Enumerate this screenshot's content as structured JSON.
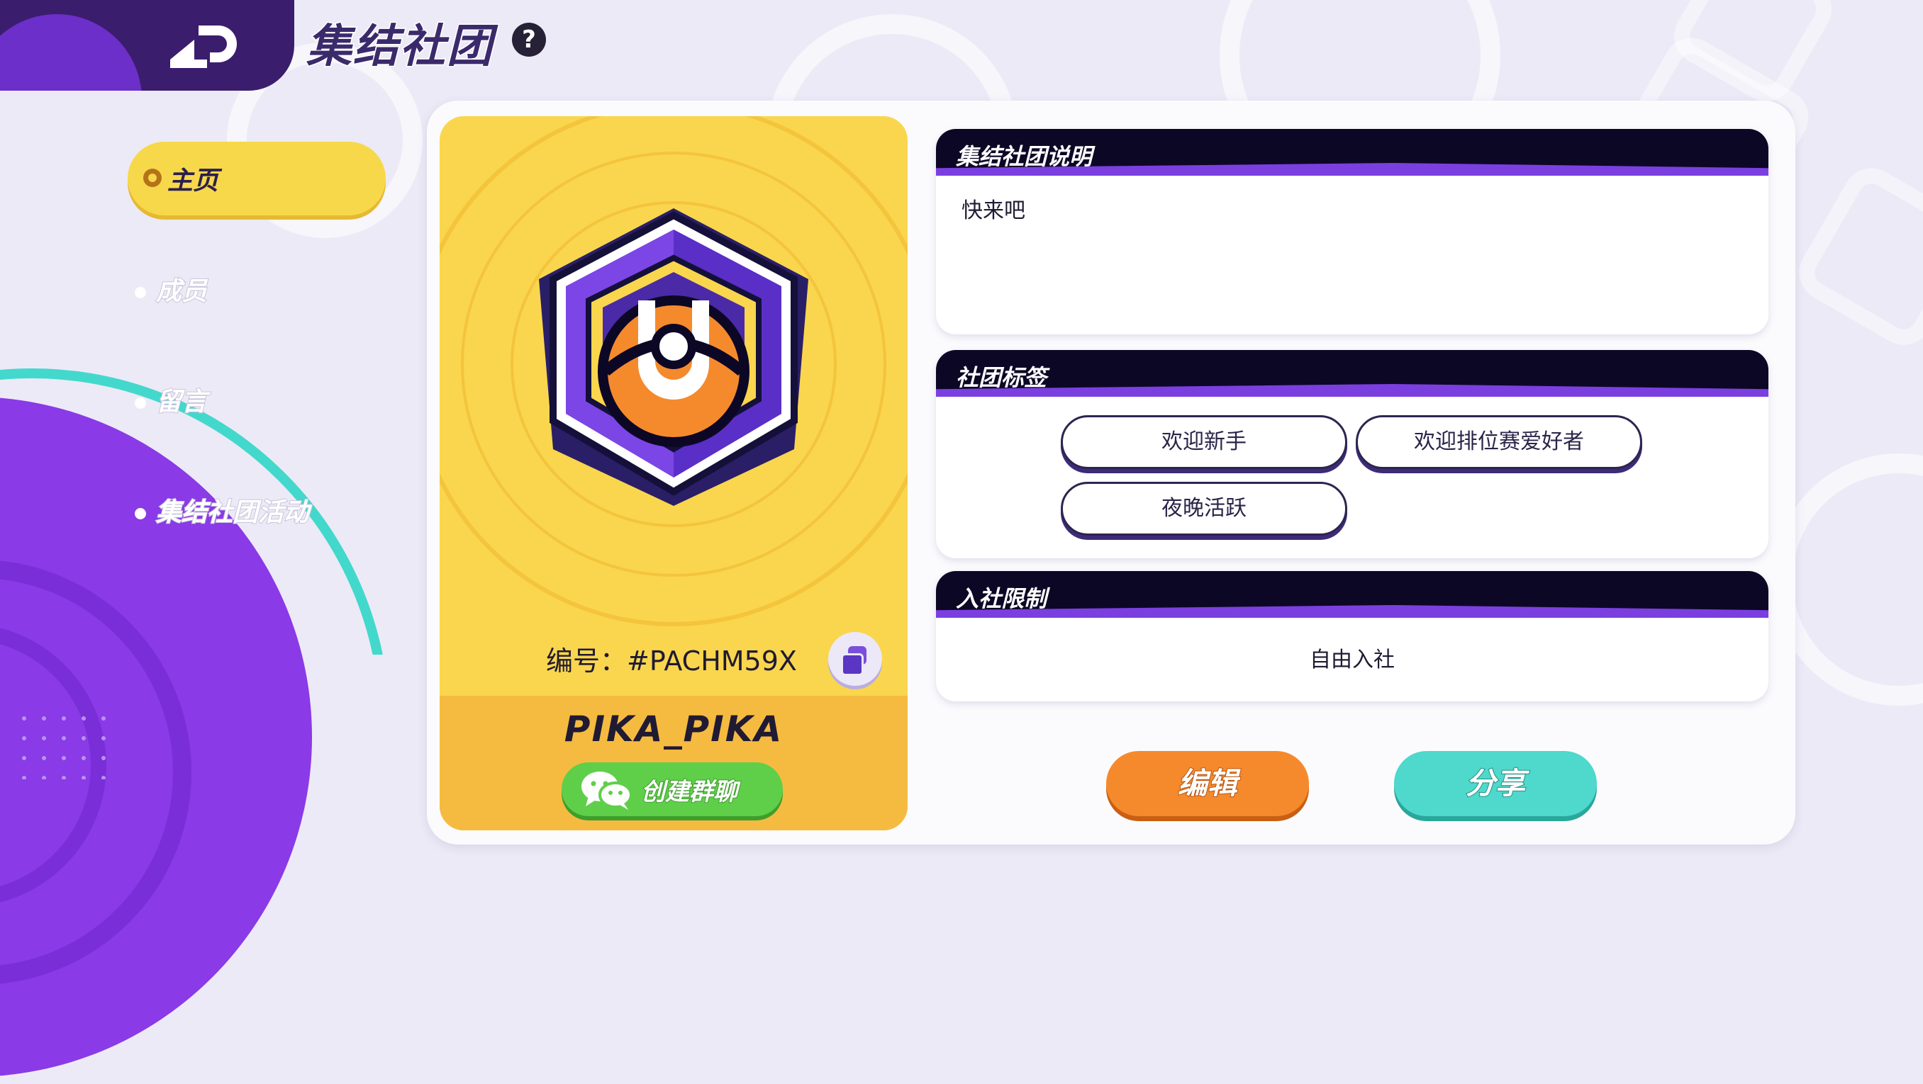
{
  "header": {
    "title": "集结社团",
    "help_symbol": "?"
  },
  "sidebar": {
    "items": [
      {
        "label": "主页",
        "active": true
      },
      {
        "label": "成员",
        "active": false
      },
      {
        "label": "留言",
        "active": false
      },
      {
        "label": "集结社团活动",
        "active": false
      }
    ]
  },
  "club_card": {
    "code_label": "编号：",
    "code_value": "#PACHM59X",
    "name": "PIKA_PIKA",
    "create_chat_label": "创建群聊"
  },
  "description": {
    "title": "集结社团说明",
    "text": "快来吧"
  },
  "tags": {
    "title": "社团标签",
    "items": [
      "欢迎新手",
      "欢迎排位赛爱好者",
      "夜晚活跃"
    ]
  },
  "join_limit": {
    "title": "入社限制",
    "value": "自由入社"
  },
  "actions": {
    "edit_label": "编辑",
    "share_label": "分享"
  },
  "colors": {
    "accent_purple": "#7b3fe0",
    "header_dark": "#0d0726",
    "card_yellow": "#f9d64d",
    "edit_orange": "#f58a2c",
    "share_teal": "#4fd8cc",
    "chat_green": "#5fcf4a"
  },
  "icons": {
    "back": "back-arrow-icon",
    "help": "question-icon",
    "nav_active": "pokeball-icon",
    "copy": "copy-icon",
    "chat": "wechat-icon",
    "emblem": "club-emblem-icon"
  }
}
